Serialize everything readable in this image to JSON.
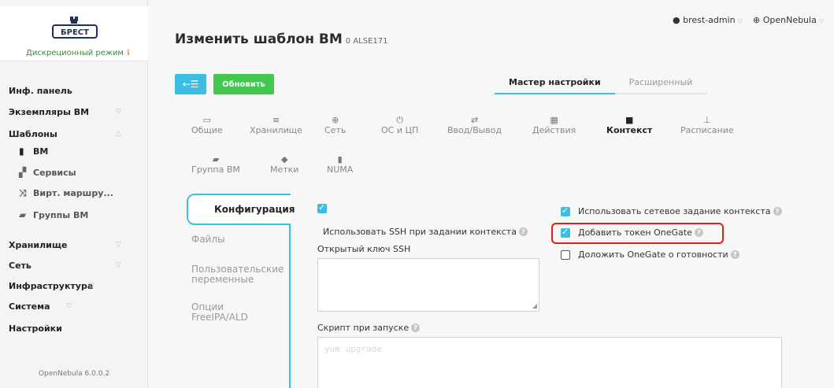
{
  "brand": {
    "logo_text": "БРЕСТ",
    "mode_label": "Дискреционный режим",
    "mode_indicator": "ℹ"
  },
  "sidebar": {
    "items": [
      {
        "label": "Инф. панель"
      },
      {
        "label": "Экземпляры ВМ"
      },
      {
        "label": "Шаблоны"
      },
      {
        "label": "Хранилище"
      },
      {
        "label": "Сеть"
      },
      {
        "label": "Инфраструктура"
      },
      {
        "label": "Система"
      },
      {
        "label": "Настройки"
      }
    ],
    "templates_sub": [
      {
        "label": "ВМ",
        "icon": "file-icon"
      },
      {
        "label": "Сервисы",
        "icon": "files-icon"
      },
      {
        "label": "Вирт. маршру...",
        "icon": "shuffle-icon"
      },
      {
        "label": "Группы ВМ",
        "icon": "folder-icon"
      }
    ],
    "version": "OpenNebula 6.0.0.2"
  },
  "header": {
    "title": "Изменить шаблон ВМ",
    "subtitle": "0 ALSE171",
    "user": "brest-admin",
    "zone": "OpenNebula"
  },
  "toolbar": {
    "back_icon": "←☰",
    "update_label": "Обновить"
  },
  "mode_tabs": [
    "Мастер настройки",
    "Расширенный"
  ],
  "section_tabs": [
    {
      "label": "Общие",
      "icon": "laptop-icon"
    },
    {
      "label": "Хранилище",
      "icon": "disk-icon"
    },
    {
      "label": "Сеть",
      "icon": "globe-icon"
    },
    {
      "label": "ОС и ЦП",
      "icon": "power-icon"
    },
    {
      "label": "Ввод/Вывод",
      "icon": "exchange-icon"
    },
    {
      "label": "Действия",
      "icon": "calendar-icon"
    },
    {
      "label": "Контекст",
      "icon": "folder-icon"
    },
    {
      "label": "Расписание",
      "icon": "sitemap-icon"
    },
    {
      "label": "Группа ВМ",
      "icon": "folder-open-icon"
    },
    {
      "label": "Метки",
      "icon": "tag-icon"
    },
    {
      "label": "NUMA",
      "icon": "chip-icon"
    }
  ],
  "context_tabs": {
    "active": "Конфигурация",
    "items": [
      "Файлы",
      "Пользовательские переменные",
      "Опции FreeIPA/ALD"
    ]
  },
  "config": {
    "ssh_checked": true,
    "ssh_label": "Использовать SSH при задании контекста",
    "ssh_key_label": "Открытый ключ SSH",
    "ssh_key_value": "",
    "start_script_label": "Скрипт при запуске",
    "start_script_placeholder": "yum upgrade",
    "network_label": "Использовать сетевое задание контекста",
    "network_checked": true,
    "token_label": "Добавить токен OneGate",
    "token_checked": true,
    "report_label": "Доложить OneGate о готовности",
    "report_checked": false
  },
  "colors": {
    "accent": "#3bbde4",
    "update_button": "#43c74f",
    "highlight": "#e0211b",
    "mode_text": "#3a8a3a"
  }
}
